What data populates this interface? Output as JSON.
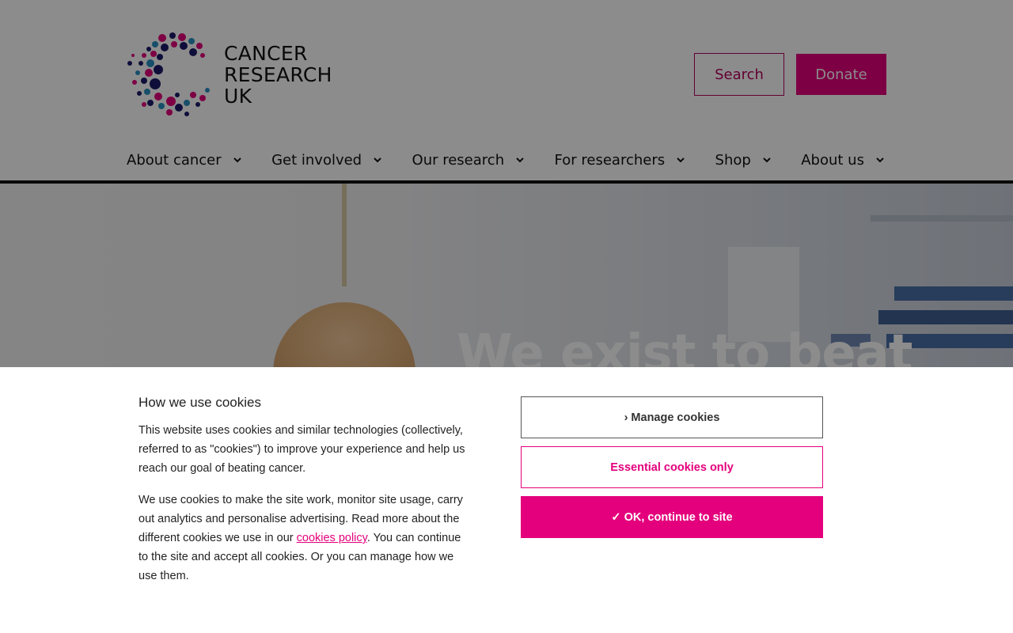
{
  "header": {
    "logo_lines": [
      "CANCER",
      "RESEARCH",
      "UK"
    ],
    "search_label": "Search",
    "donate_label": "Donate"
  },
  "nav": {
    "items": [
      {
        "label": "About cancer"
      },
      {
        "label": "Get involved"
      },
      {
        "label": "Our research"
      },
      {
        "label": "For researchers"
      },
      {
        "label": "Shop"
      },
      {
        "label": "About us"
      }
    ]
  },
  "hero": {
    "title": "We exist to beat"
  },
  "cookie_banner": {
    "title": "How we use cookies",
    "paragraph1": "This website uses cookies and similar technologies (collectively, referred to as \"cookies\") to improve your experience and help us reach our goal of beating cancer.",
    "paragraph2_before": "We use cookies to make the site work, monitor site usage, carry out analytics and personalise advertising. Read more about the different cookies we use in our ",
    "paragraph2_link": "cookies policy",
    "paragraph2_after": ". You can continue to the site and accept all cookies. Or you can manage how we use them.",
    "manage_label": "› Manage cookies",
    "essential_label": "Essential cookies only",
    "ok_label": "✓ OK, continue to site"
  },
  "colors": {
    "brand_pink": "#e4007c",
    "brand_dark_pink": "#b5005c",
    "brand_navy": "#1d1a6b",
    "brand_blue": "#2a8fc1"
  }
}
